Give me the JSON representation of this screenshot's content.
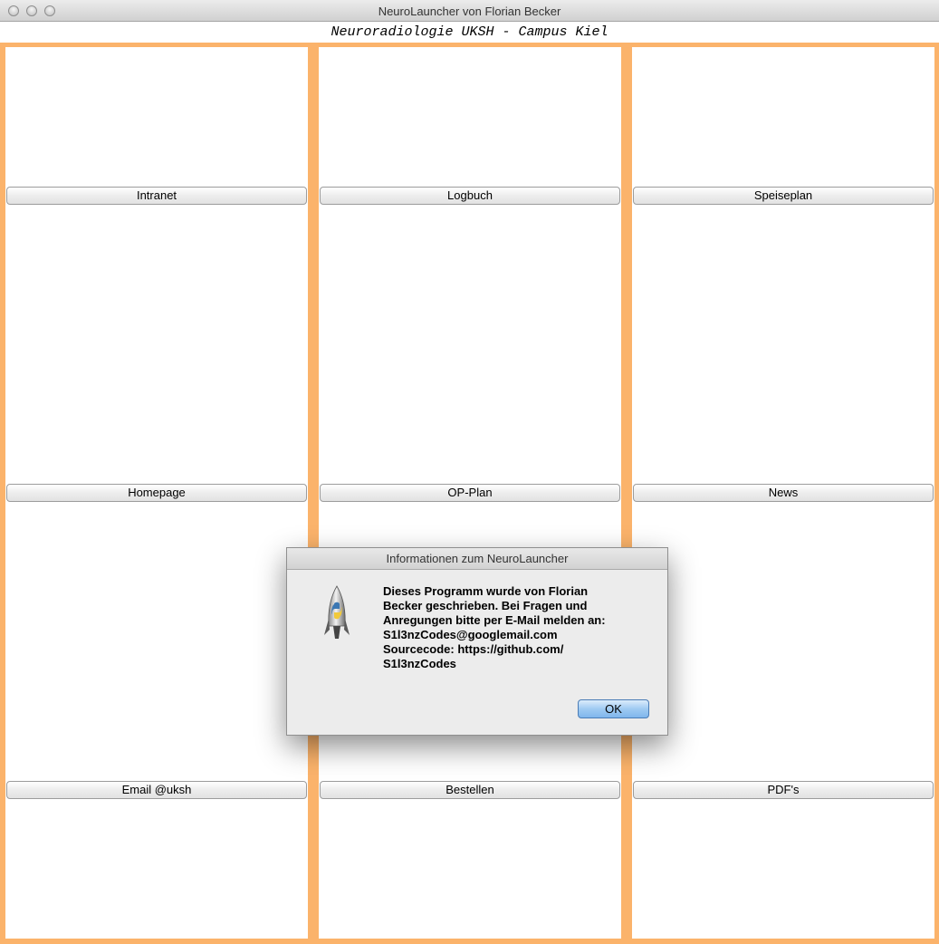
{
  "window": {
    "title": "NeuroLauncher von Florian Becker"
  },
  "header": {
    "subtitle": "Neuroradiologie UKSH - Campus Kiel"
  },
  "buttons": {
    "intranet": "Intranet",
    "logbuch": "Logbuch",
    "speiseplan": "Speiseplan",
    "homepage": "Homepage",
    "op_plan": "OP-Plan",
    "news": "News",
    "email": "Email @uksh",
    "bestellen": "Bestellen",
    "pdfs": "PDF's"
  },
  "dialog": {
    "title": "Informationen zum NeuroLauncher",
    "icon": "python-rocket-icon",
    "lines": [
      "Dieses Programm wurde von Florian",
      "Becker geschrieben. Bei Fragen und",
      "Anregungen bitte per E-Mail melden an:",
      "S1l3nzCodes@googlemail.com",
      "Sourcecode: https://github.com/",
      "S1l3nzCodes"
    ],
    "ok_label": "OK"
  },
  "colors": {
    "frame": "#fbb36b",
    "ok_button": "#8fc0f0"
  }
}
